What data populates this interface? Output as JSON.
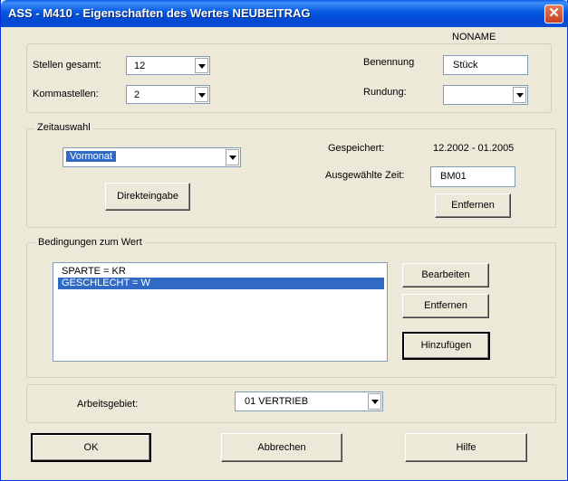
{
  "window": {
    "title": "ASS - M410 - Eigenschaften des Wertes NEUBEITRAG",
    "close_symbol": "✕"
  },
  "header": {
    "noname": "NONAME"
  },
  "format": {
    "stellen_label": "Stellen gesamt:",
    "stellen_value": "12",
    "komma_label": "Kommastellen:",
    "komma_value": "2",
    "benennung_label": "Benennung",
    "benennung_value": "Stück",
    "rundung_label": "Rundung:",
    "rundung_value": ""
  },
  "zeitauswahl": {
    "legend": "Zeitauswahl",
    "period_value": "Vormonat",
    "direkteingabe_label": "Direkteingabe",
    "gespeichert_label": "Gespeichert:",
    "gespeichert_value": "12.2002 - 01.2005",
    "ausgewaehlt_label": "Ausgewählte Zeit:",
    "ausgewaehlt_value": "BM01",
    "entfernen_label": "Entfernen"
  },
  "bedingungen": {
    "legend": "Bedingungen zum Wert",
    "items": [
      "SPARTE = KR",
      "GESCHLECHT = W"
    ],
    "bearbeiten_label": "Bearbeiten",
    "entfernen_label": "Entfernen",
    "hinzufuegen_label": "Hinzufügen"
  },
  "arbeitsgebiet": {
    "label": "Arbeitsgebiet:",
    "value": "01  VERTRIEB"
  },
  "footer": {
    "ok_label": "OK",
    "abbrechen_label": "Abbrechen",
    "hilfe_label": "Hilfe"
  }
}
